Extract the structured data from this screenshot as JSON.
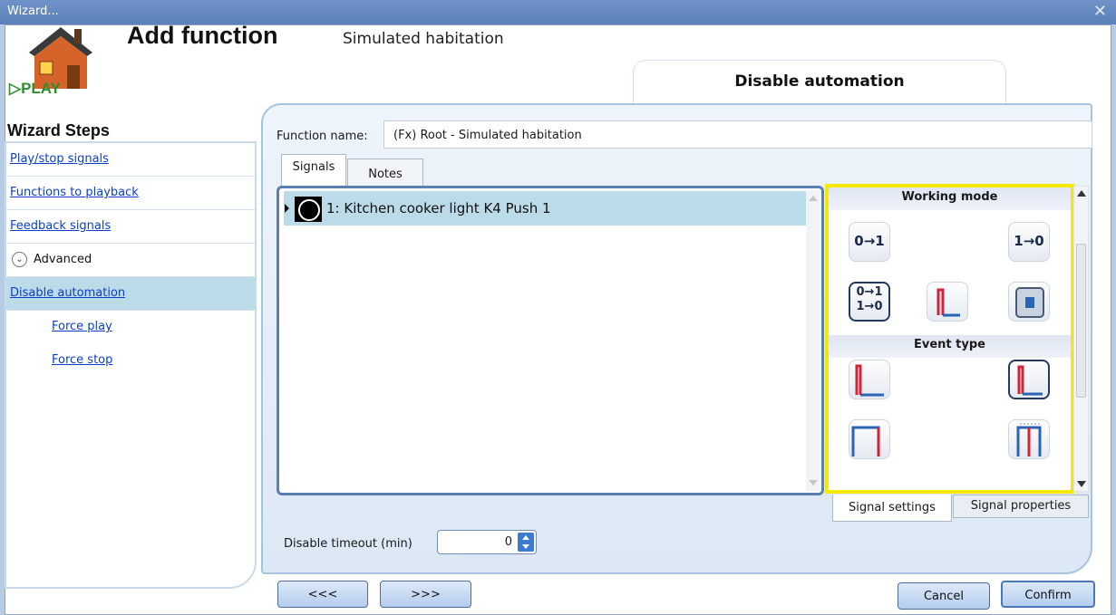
{
  "window": {
    "title": "Wizard...",
    "close_icon": "close-icon"
  },
  "header": {
    "title": "Add function",
    "subtitle": "Simulated habitation",
    "step_tab": "Disable automation",
    "logo_text": "PLAY"
  },
  "sidebar": {
    "title": "Wizard Steps",
    "items": [
      {
        "label": "Play/stop signals"
      },
      {
        "label": "Functions to playback"
      },
      {
        "label": "Feedback signals"
      }
    ],
    "advanced_label": "Advanced",
    "active_item": "Disable automation",
    "sub_items": [
      {
        "label": "Force play"
      },
      {
        "label": "Force stop"
      }
    ]
  },
  "form": {
    "function_name_label": "Function name:",
    "function_name_value": "(Fx) Root - Simulated habitation",
    "tabs": [
      {
        "label": "Signals"
      },
      {
        "label": "Notes"
      }
    ],
    "signals": [
      {
        "label": "1: Kitchen cooker light K4 Push 1"
      }
    ],
    "timeout_label": "Disable timeout (min)",
    "timeout_value": "0"
  },
  "settings_panel": {
    "working_mode_title": "Working mode",
    "event_type_title": "Event type",
    "mode_rise": "0→1",
    "mode_fall": "1→0",
    "mode_both_top": "0→1",
    "mode_both_bottom": "1→0",
    "tabs": [
      {
        "label": "Signal settings"
      },
      {
        "label": "Signal properties"
      }
    ]
  },
  "footer": {
    "prev_label": "<<<",
    "next_label": ">>>",
    "cancel_label": "Cancel",
    "confirm_label": "Confirm"
  },
  "colors": {
    "highlight": "#f6e900",
    "selected_row": "#bcdbe9",
    "link": "#0b3fcc"
  }
}
